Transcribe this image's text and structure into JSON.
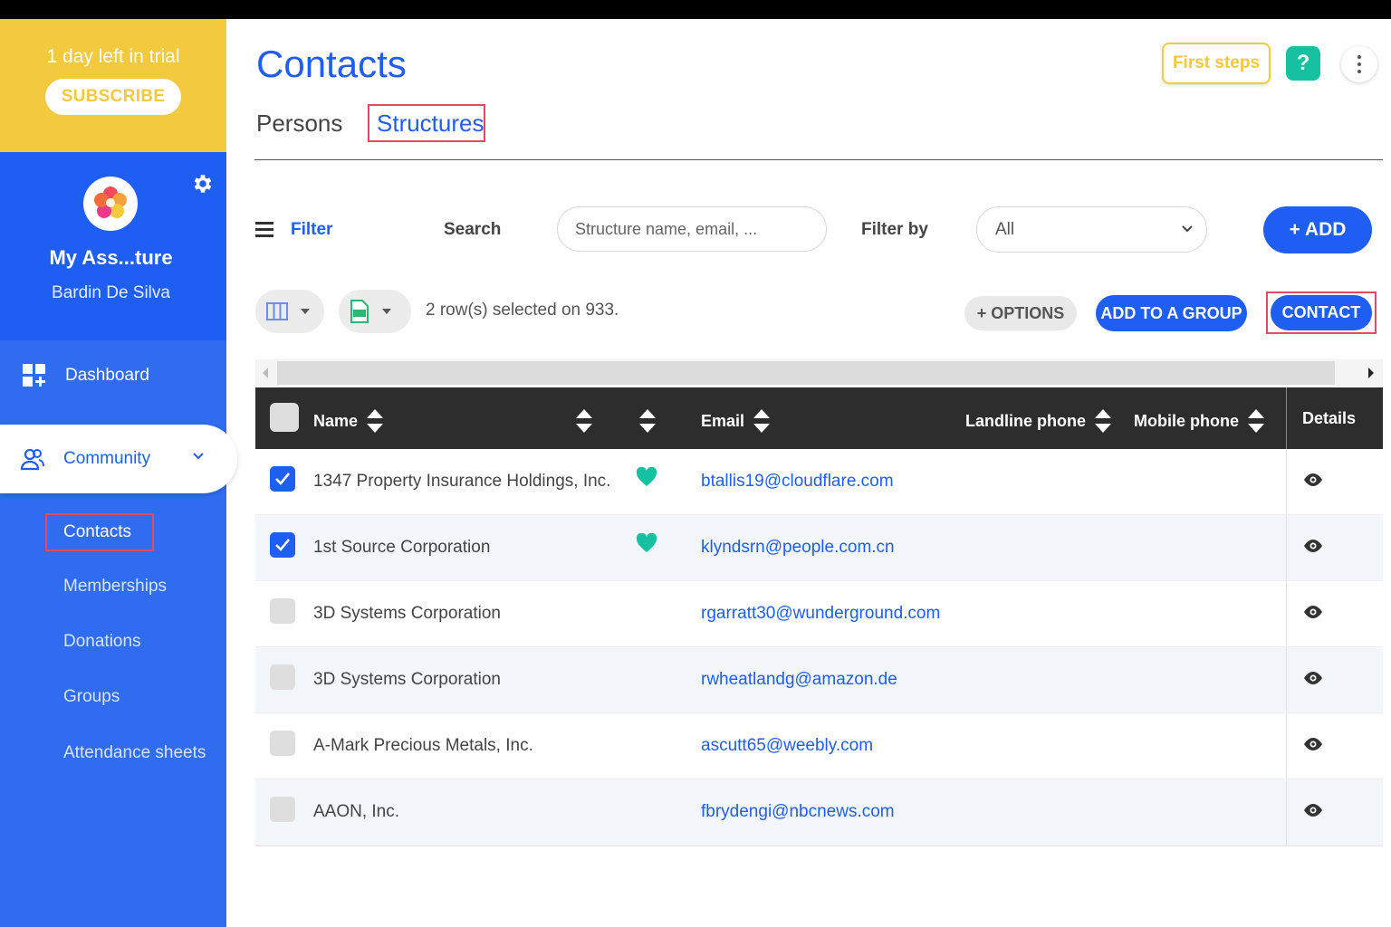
{
  "trial": {
    "text": "1 day left in trial",
    "subscribe_label": "SUBSCRIBE"
  },
  "profile": {
    "org_name": "My Ass...ture",
    "user_name": "Bardin De Silva"
  },
  "nav": {
    "dashboard": "Dashboard",
    "community": "Community",
    "sub_items": [
      "Contacts",
      "Memberships",
      "Donations",
      "Groups",
      "Attendance sheets"
    ]
  },
  "header": {
    "title": "Contacts",
    "first_steps_label": "First steps",
    "help_label": "?"
  },
  "tabs": [
    "Persons",
    "Structures"
  ],
  "toolbar": {
    "filter_label": "Filter",
    "search_label": "Search",
    "search_placeholder": "Structure name, email, ...",
    "filter_by_label": "Filter by",
    "filter_by_value": "All",
    "add_label": "+ ADD"
  },
  "actions": {
    "selected_text": "2 row(s) selected on 933.",
    "options_label": "+ OPTIONS",
    "add_to_group_label": "ADD TO A GROUP",
    "contact_label": "CONTACT"
  },
  "table": {
    "columns": {
      "name": "Name",
      "email": "Email",
      "landline": "Landline phone",
      "mobile": "Mobile phone",
      "details": "Details"
    },
    "rows": [
      {
        "name": "1347 Property Insurance Holdings, Inc.",
        "email": "btallis19@cloudflare.com",
        "checked": true,
        "favorite": true
      },
      {
        "name": "1st Source Corporation",
        "email": "klyndsrn@people.com.cn",
        "checked": true,
        "favorite": true
      },
      {
        "name": "3D Systems Corporation",
        "email": "rgarratt30@wunderground.com",
        "checked": false,
        "favorite": false
      },
      {
        "name": "3D Systems Corporation",
        "email": "rwheatlandg@amazon.de",
        "checked": false,
        "favorite": false
      },
      {
        "name": "A-Mark Precious Metals, Inc.",
        "email": "ascutt65@weebly.com",
        "checked": false,
        "favorite": false
      },
      {
        "name": "AAON, Inc.",
        "email": "fbrydengi@nbcnews.com",
        "checked": false,
        "favorite": false
      }
    ]
  },
  "colors": {
    "primary": "#1f5ef2",
    "sidebar": "#2f6cf0",
    "trial": "#f3c93e",
    "accent": "#15c1a0",
    "highlight": "#e14a5f"
  }
}
